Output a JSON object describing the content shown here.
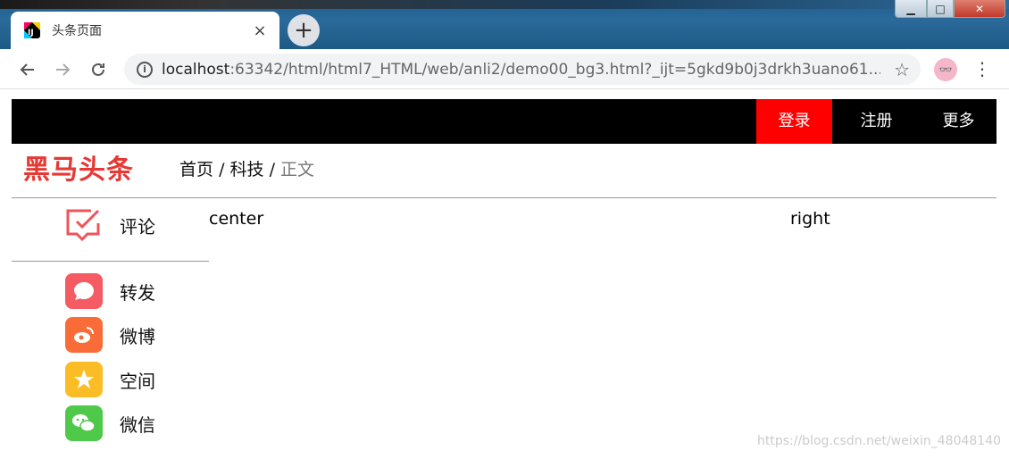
{
  "browser": {
    "tab_title": "头条页面",
    "tab_close": "×",
    "new_tab": "+",
    "url_host": "localhost",
    "url_rest": ":63342/html/html7_HTML/web/anli2/demo00_bg3.html?_ijt=5gkd9b0j3drkh3uano61...",
    "icons": [
      "back-icon",
      "forward-icon",
      "reload-icon",
      "info-icon",
      "star-icon",
      "avatar",
      "menu-icon"
    ]
  },
  "topbar": {
    "links": [
      "登录",
      "注册",
      "更多"
    ],
    "active_color": "#ff0000"
  },
  "header": {
    "logo": "黑马头条",
    "breadcrumb": [
      "首页",
      "科技",
      "正文"
    ],
    "separator": "/"
  },
  "sidebar": {
    "comment_label": "评论",
    "share": [
      {
        "label": "转发",
        "icon": "message-icon",
        "color": "#f55b63"
      },
      {
        "label": "微博",
        "icon": "weibo-icon",
        "color": "#f96c37"
      },
      {
        "label": "空间",
        "icon": "qzone-icon",
        "color": "#fbbd26"
      },
      {
        "label": "微信",
        "icon": "wechat-icon",
        "color": "#4ec94a"
      }
    ]
  },
  "main": {
    "center": "center",
    "right": "right"
  },
  "watermark": "https://blog.csdn.net/weixin_48048140"
}
